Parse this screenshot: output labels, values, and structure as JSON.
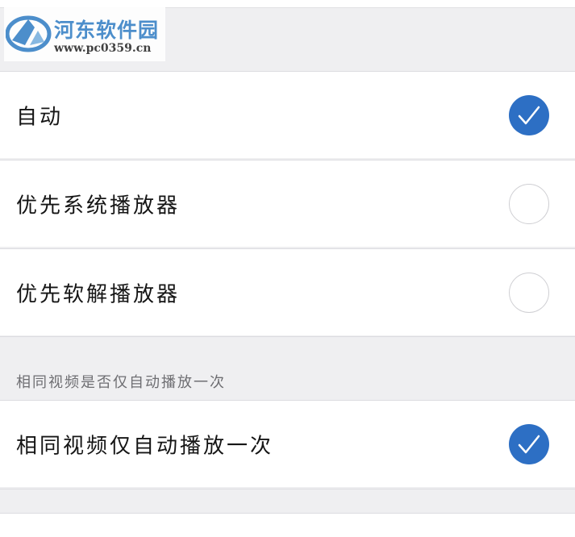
{
  "watermark": {
    "title": "河东软件园",
    "url": "www.pc0359.cn"
  },
  "player_options": [
    {
      "label": "自动",
      "selected": true
    },
    {
      "label": "优先系统播放器",
      "selected": false
    },
    {
      "label": "优先软解播放器",
      "selected": false
    }
  ],
  "autoplay_section": {
    "header": "相同视频是否仅自动播放一次",
    "option": {
      "label": "相同视频仅自动播放一次",
      "checked": true
    }
  },
  "colors": {
    "accent": "#2d6fc4",
    "background": "#efeff1",
    "row_background": "#ffffff",
    "watermark_blue": "#3f86c8"
  },
  "icons": {
    "checkmark": "checkmark-icon",
    "logo": "hedong-logo-icon"
  }
}
